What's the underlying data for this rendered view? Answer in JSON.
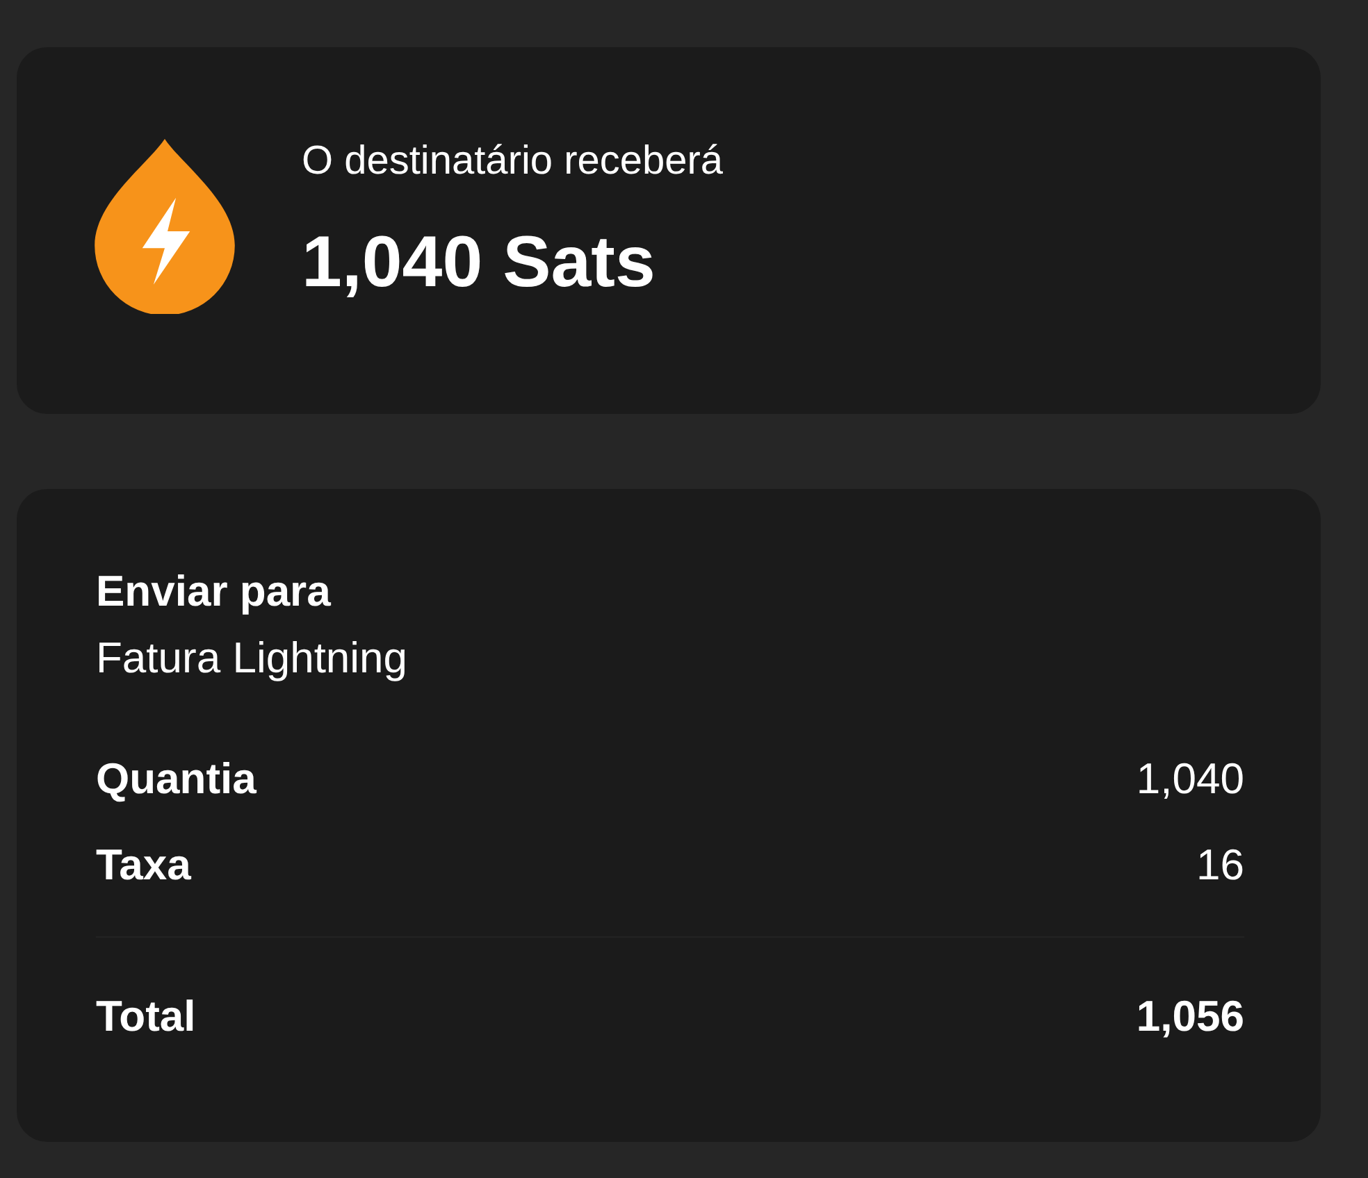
{
  "summary": {
    "label": "O destinatário receberá",
    "amount": "1,040 Sats"
  },
  "details": {
    "send_to_label": "Enviar para",
    "send_to_value": "Fatura Lightning",
    "rows": [
      {
        "kind": "line",
        "label": "Quantia",
        "value": "1,040"
      },
      {
        "kind": "line",
        "label": "Taxa",
        "value": "16"
      },
      {
        "kind": "total",
        "label": "Total",
        "value": "1,056"
      }
    ]
  }
}
